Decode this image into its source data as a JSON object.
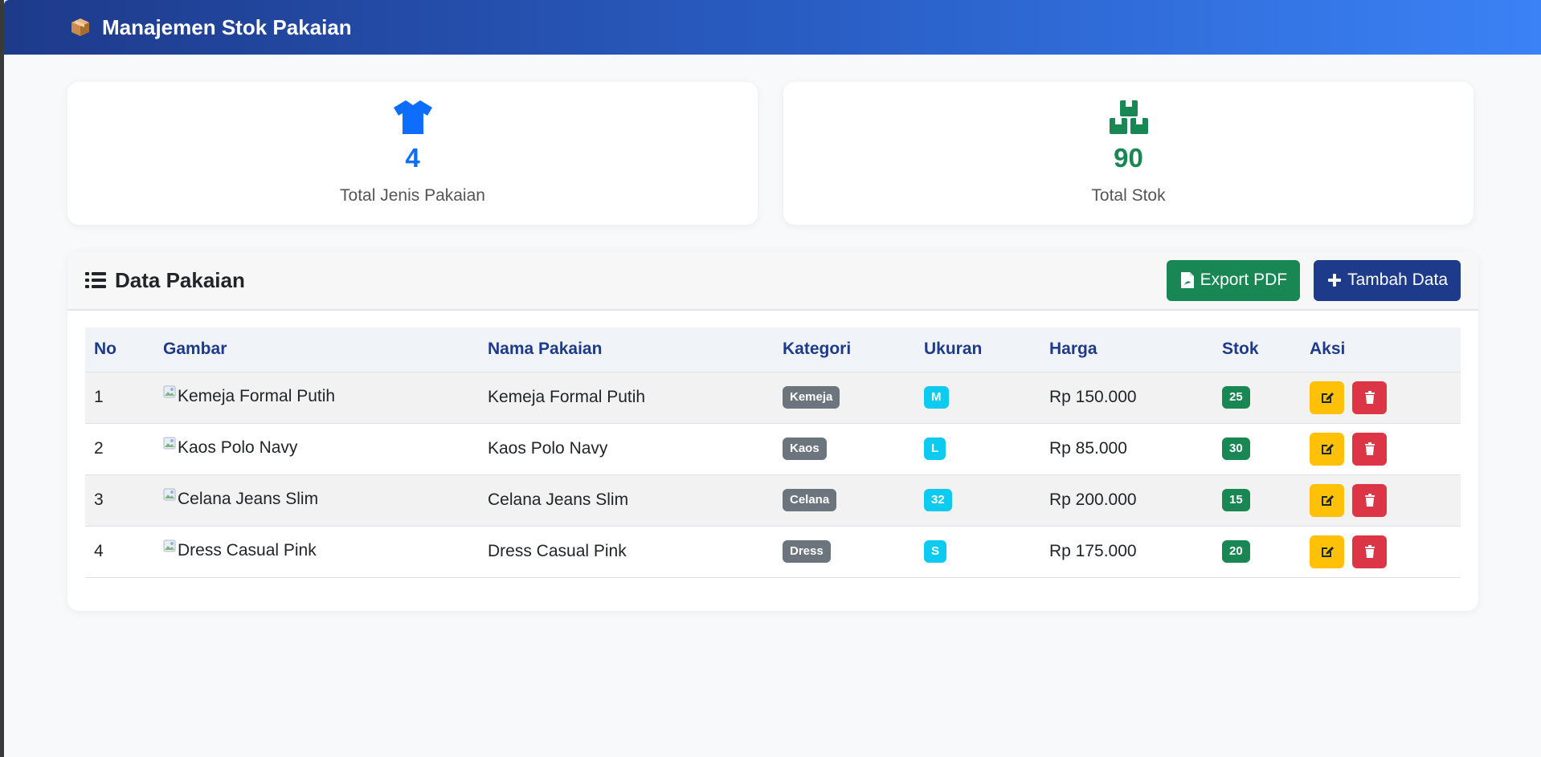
{
  "navbar": {
    "title": "Manajemen Stok Pakaian",
    "icon": "package-icon"
  },
  "stats": [
    {
      "value": "4",
      "label": "Total Jenis Pakaian",
      "icon": "shirt-icon",
      "color": "#0d6efd"
    },
    {
      "value": "90",
      "label": "Total Stok",
      "icon": "boxes-icon",
      "color": "#198754"
    }
  ],
  "panel": {
    "title": "Data Pakaian",
    "export_label": "Export PDF",
    "add_label": "Tambah Data"
  },
  "table": {
    "headers": [
      "No",
      "Gambar",
      "Nama Pakaian",
      "Kategori",
      "Ukuran",
      "Harga",
      "Stok",
      "Aksi"
    ],
    "rows": [
      {
        "no": "1",
        "image_alt": "Kemeja Formal Putih",
        "name": "Kemeja Formal Putih",
        "category": "Kemeja",
        "size": "M",
        "price": "Rp 150.000",
        "stock": "25"
      },
      {
        "no": "2",
        "image_alt": "Kaos Polo Navy",
        "name": "Kaos Polo Navy",
        "category": "Kaos",
        "size": "L",
        "price": "Rp 85.000",
        "stock": "30"
      },
      {
        "no": "3",
        "image_alt": "Celana Jeans Slim",
        "name": "Celana Jeans Slim",
        "category": "Celana",
        "size": "32",
        "price": "Rp 200.000",
        "stock": "15"
      },
      {
        "no": "4",
        "image_alt": "Dress Casual Pink",
        "name": "Dress Casual Pink",
        "category": "Dress",
        "size": "S",
        "price": "Rp 175.000",
        "stock": "20"
      }
    ]
  },
  "colors": {
    "navy": "#1e3a8a",
    "green": "#198754",
    "blue": "#0d6efd",
    "warning": "#ffc107",
    "danger": "#dc3545",
    "info": "#0dcaf0",
    "secondary": "#6c757d"
  }
}
